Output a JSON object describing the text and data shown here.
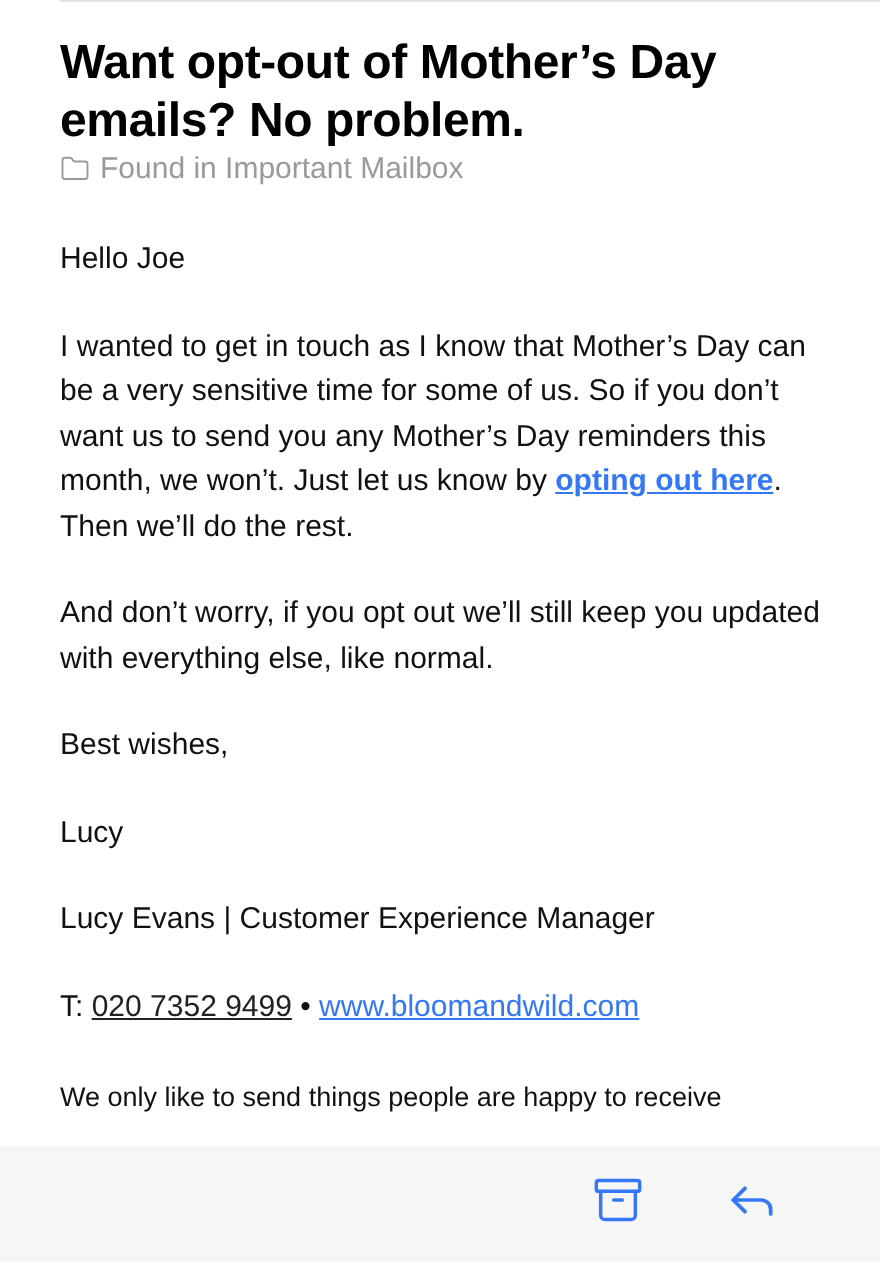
{
  "subject": "Want opt-out of Mother’s Day emails? No problem.",
  "mailbox": "Found in Important Mailbox",
  "body": [
    {
      "kind": "paragraph",
      "parts": [
        {
          "kind": "text",
          "text": "Hello Joe"
        }
      ]
    },
    {
      "kind": "paragraph",
      "parts": [
        {
          "kind": "text",
          "text": "I wanted to get in touch as I know that Mother’s Day can be a very sensitive time for some of us. So if you don’t want us to send you any Mother’s Day reminders this month, we won’t. Just let us know by "
        },
        {
          "kind": "bold-link",
          "text": "opting out here"
        },
        {
          "kind": "text",
          "text": ". Then we’ll do the rest."
        }
      ]
    },
    {
      "kind": "paragraph",
      "parts": [
        {
          "kind": "text",
          "text": "And don’t worry, if you opt out we’ll still keep you updated with everything else, like normal."
        }
      ]
    },
    {
      "kind": "paragraph",
      "parts": [
        {
          "kind": "text",
          "text": "Best wishes,"
        }
      ]
    },
    {
      "kind": "paragraph",
      "parts": [
        {
          "kind": "text",
          "text": "Lucy"
        }
      ]
    },
    {
      "kind": "paragraph",
      "parts": [
        {
          "kind": "text",
          "text": "Lucy Evans | Customer Experience Manager"
        }
      ]
    },
    {
      "kind": "paragraph",
      "parts": [
        {
          "kind": "text",
          "text": "T: "
        },
        {
          "kind": "phone-link",
          "text": "020 7352 9499"
        },
        {
          "kind": "text",
          "text": " • "
        },
        {
          "kind": "link",
          "text": "www.bloomandwild.com"
        }
      ]
    },
    {
      "kind": "small",
      "parts": [
        {
          "kind": "text",
          "text": "We only like to send things people are happy to receive"
        }
      ]
    }
  ]
}
